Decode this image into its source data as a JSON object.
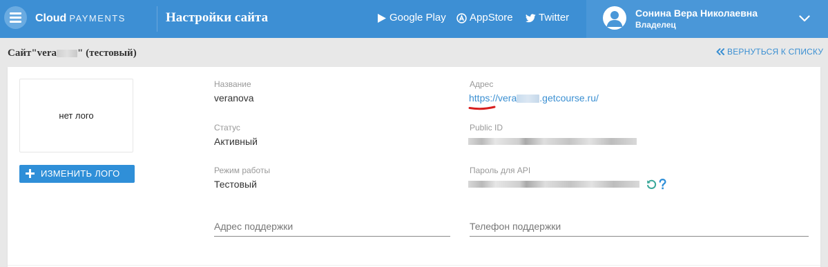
{
  "header": {
    "brand_bold": "Cloud",
    "brand_light": "PAYMENTS",
    "page_title": "Настройки сайта",
    "links": [
      {
        "label": "Google Play",
        "icon": "google-play-icon"
      },
      {
        "label": "AppStore",
        "icon": "appstore-icon"
      },
      {
        "label": "Twitter",
        "icon": "twitter-icon"
      }
    ],
    "user": {
      "name": "Сонина Вера Николаевна",
      "role": "Владелец",
      "icon": "user-avatar-icon"
    },
    "colors": {
      "bar": "#3d8fd4",
      "user_panel": "#4a97d8"
    }
  },
  "subheader": {
    "site_title_prefix": "Сайт\"vera",
    "site_title_suffix": "\" (тестовый)",
    "back_label": "ВЕРНУТЬСЯ К СПИСКУ"
  },
  "logo": {
    "placeholder": "нет лого",
    "change_label": "ИЗМЕНИТЬ ЛОГО"
  },
  "fields": {
    "name_label": "Название",
    "name_value": "veranova",
    "status_label": "Статус",
    "status_value": "Активный",
    "mode_label": "Режим работы",
    "mode_value": "Тестовый",
    "address_label": "Адрес",
    "address_prefix": "https://vera",
    "address_suffix": ".getcourse.ru/",
    "public_id_label": "Public ID",
    "api_password_label": "Пароль для API",
    "support_address_placeholder": "Адрес поддержки",
    "support_phone_placeholder": "Телефон поддержки"
  },
  "colors": {
    "accent": "#3a8fd2",
    "button": "#2f8fd8",
    "annotation": "#d81e1e",
    "icon_green": "#3aa89a"
  }
}
